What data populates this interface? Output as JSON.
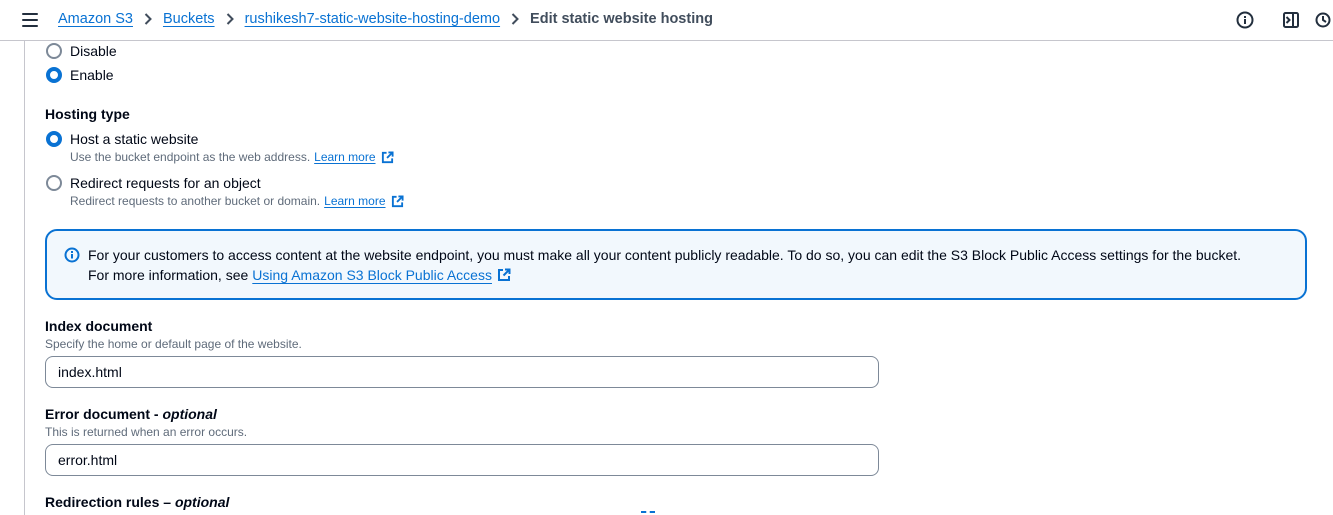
{
  "topbar": {
    "breadcrumbs": [
      "Amazon S3",
      "Buckets",
      "rushikesh7-static-website-hosting-demo"
    ],
    "current": "Edit static website hosting",
    "icons": [
      "menu-icon",
      "info-icon",
      "split-panel-icon",
      "notifications-icon"
    ]
  },
  "static_hosting": {
    "options": [
      {
        "label": "Disable",
        "selected": false
      },
      {
        "label": "Enable",
        "selected": true
      }
    ]
  },
  "hosting_type": {
    "label": "Hosting type",
    "options": [
      {
        "label": "Host a static website",
        "desc": "Use the bucket endpoint as the web address.",
        "link": "Learn more",
        "selected": true
      },
      {
        "label": "Redirect requests for an object",
        "desc": "Redirect requests to another bucket or domain.",
        "link": "Learn more",
        "selected": false
      }
    ]
  },
  "alert": {
    "line1": "For your customers to access content at the website endpoint, you must make all your content publicly readable. To do so, you can edit the S3 Block Public Access settings for the bucket.",
    "line2_prefix": "For more information, see",
    "link": "Using Amazon S3 Block Public Access"
  },
  "index_document": {
    "label": "Index document",
    "desc": "Specify the home or default page of the website.",
    "value": "index.html"
  },
  "error_document": {
    "label": "Error document",
    "optional": "optional",
    "desc": "This is returned when an error occurs.",
    "value": "error.html"
  },
  "redirection_rules": {
    "label": "Redirection rules",
    "optional": "optional"
  },
  "colors": {
    "accent": "#0972d3",
    "alert_bg": "#f2f8fd",
    "text": "#000716",
    "secondary_text": "#5f6b7a"
  }
}
